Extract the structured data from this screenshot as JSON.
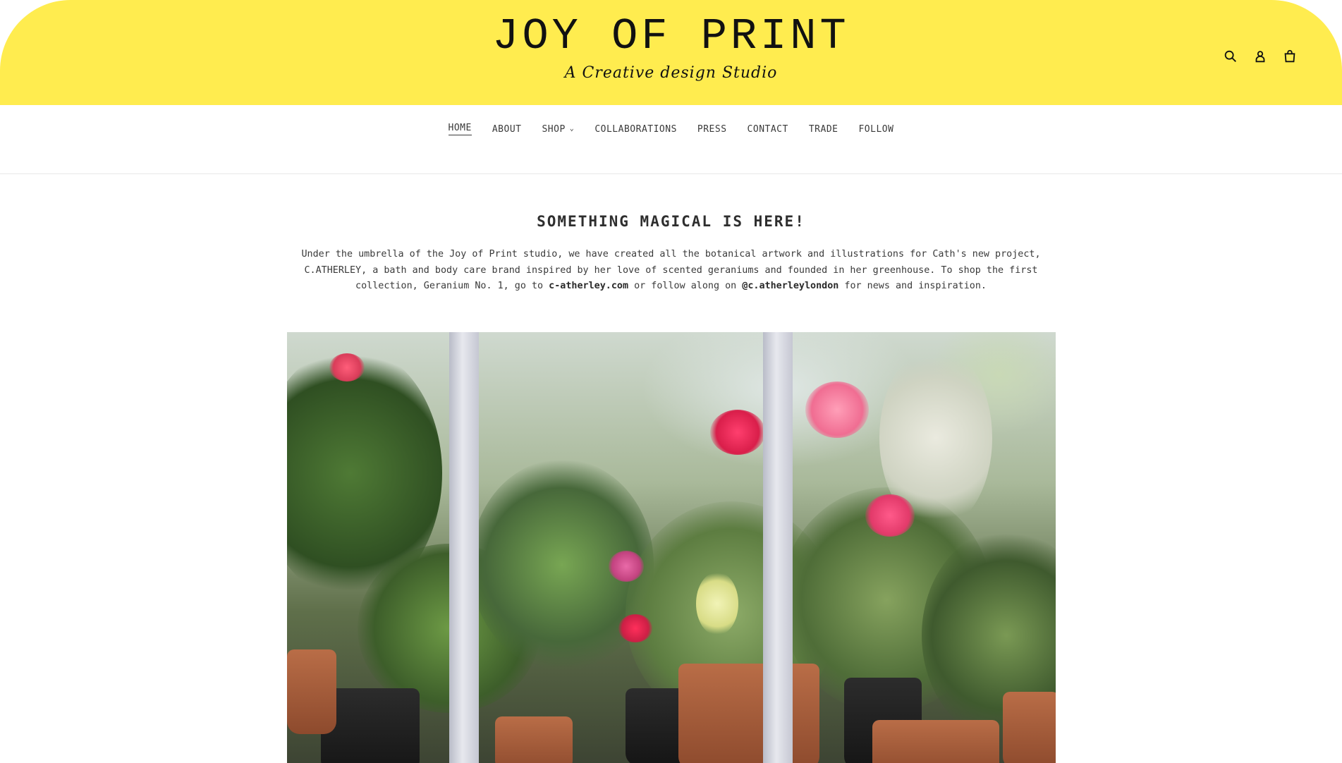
{
  "header": {
    "title": "JOY OF PRINT",
    "tagline": "A Creative design Studio",
    "background_color": "#FFEC4F",
    "icons": [
      "search-icon",
      "account-icon",
      "cart-icon"
    ]
  },
  "nav": {
    "items": [
      {
        "label": "HOME",
        "active": true
      },
      {
        "label": "ABOUT",
        "active": false
      },
      {
        "label": "SHOP",
        "active": false,
        "has_dropdown": true
      },
      {
        "label": "COLLABORATIONS",
        "active": false
      },
      {
        "label": "PRESS",
        "active": false
      },
      {
        "label": "CONTACT",
        "active": false
      },
      {
        "label": "TRADE",
        "active": false
      },
      {
        "label": "FOLLOW",
        "active": false
      }
    ]
  },
  "main": {
    "headline": "SOMETHING MAGICAL IS HERE!",
    "intro": {
      "part1": "Under the umbrella of the Joy of Print studio, we have created all the botanical artwork and illustrations for Cath's new project, C.ATHERLEY, a bath and body care brand inspired by her love of scented geraniums and founded in her greenhouse. To shop the first collection, Geranium No. 1, go to ",
      "link1": "c-atherley.com",
      "part2": " or follow along on ",
      "link2": "@c.atherleylondon",
      "part3": " for news and inspiration."
    },
    "hero_image_subject": "potted geraniums in a greenhouse"
  }
}
